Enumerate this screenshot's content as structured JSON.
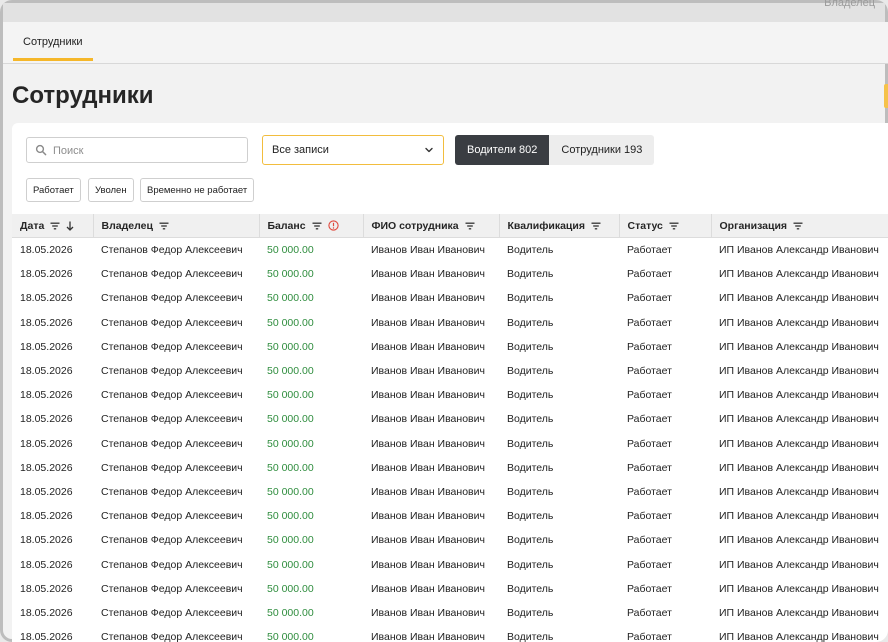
{
  "topbar": {
    "owner_link": "Владелец"
  },
  "tabs": [
    {
      "label": "Сотрудники"
    }
  ],
  "page": {
    "title": "Сотрудники"
  },
  "toolbar": {
    "search": {
      "placeholder": "Поиск",
      "value": ""
    },
    "records_select": {
      "value": "Все записи"
    },
    "segments": [
      {
        "label": "Водители 802",
        "active": true
      },
      {
        "label": "Сотрудники 193",
        "active": false
      }
    ],
    "status_chips": [
      "Работает",
      "Уволен",
      "Временно не работает"
    ]
  },
  "colors": {
    "accent": "#f5b72a",
    "money": "#2f8d3e",
    "segment_active": "#3a3d42",
    "info_icon": "#e0483c"
  },
  "table": {
    "columns": [
      {
        "label": "Дата",
        "filter": true,
        "sorted": "desc"
      },
      {
        "label": "Владелец",
        "filter": true
      },
      {
        "label": "Баланс",
        "filter": true,
        "info": true
      },
      {
        "label": "ФИО сотрудника",
        "filter": true
      },
      {
        "label": "Квалификация",
        "filter": true
      },
      {
        "label": "Статус",
        "filter": true
      },
      {
        "label": "Организация",
        "filter": true
      }
    ],
    "rows": [
      [
        "18.05.2026",
        "Степанов Федор Алексеевич",
        "50 000.00",
        "Иванов Иван Иванович",
        "Водитель",
        "Работает",
        "ИП Иванов Александр Иванович"
      ],
      [
        "18.05.2026",
        "Степанов Федор Алексеевич",
        "50 000.00",
        "Иванов Иван Иванович",
        "Водитель",
        "Работает",
        "ИП Иванов Александр Иванович"
      ],
      [
        "18.05.2026",
        "Степанов Федор Алексеевич",
        "50 000.00",
        "Иванов Иван Иванович",
        "Водитель",
        "Работает",
        "ИП Иванов Александр Иванович"
      ],
      [
        "18.05.2026",
        "Степанов Федор Алексеевич",
        "50 000.00",
        "Иванов Иван Иванович",
        "Водитель",
        "Работает",
        "ИП Иванов Александр Иванович"
      ],
      [
        "18.05.2026",
        "Степанов Федор Алексеевич",
        "50 000.00",
        "Иванов Иван Иванович",
        "Водитель",
        "Работает",
        "ИП Иванов Александр Иванович"
      ],
      [
        "18.05.2026",
        "Степанов Федор Алексеевич",
        "50 000.00",
        "Иванов Иван Иванович",
        "Водитель",
        "Работает",
        "ИП Иванов Александр Иванович"
      ],
      [
        "18.05.2026",
        "Степанов Федор Алексеевич",
        "50 000.00",
        "Иванов Иван Иванович",
        "Водитель",
        "Работает",
        "ИП Иванов Александр Иванович"
      ],
      [
        "18.05.2026",
        "Степанов Федор Алексеевич",
        "50 000.00",
        "Иванов Иван Иванович",
        "Водитель",
        "Работает",
        "ИП Иванов Александр Иванович"
      ],
      [
        "18.05.2026",
        "Степанов Федор Алексеевич",
        "50 000.00",
        "Иванов Иван Иванович",
        "Водитель",
        "Работает",
        "ИП Иванов Александр Иванович"
      ],
      [
        "18.05.2026",
        "Степанов Федор Алексеевич",
        "50 000.00",
        "Иванов Иван Иванович",
        "Водитель",
        "Работает",
        "ИП Иванов Александр Иванович"
      ],
      [
        "18.05.2026",
        "Степанов Федор Алексеевич",
        "50 000.00",
        "Иванов Иван Иванович",
        "Водитель",
        "Работает",
        "ИП Иванов Александр Иванович"
      ],
      [
        "18.05.2026",
        "Степанов Федор Алексеевич",
        "50 000.00",
        "Иванов Иван Иванович",
        "Водитель",
        "Работает",
        "ИП Иванов Александр Иванович"
      ],
      [
        "18.05.2026",
        "Степанов Федор Алексеевич",
        "50 000.00",
        "Иванов Иван Иванович",
        "Водитель",
        "Работает",
        "ИП Иванов Александр Иванович"
      ],
      [
        "18.05.2026",
        "Степанов Федор Алексеевич",
        "50 000.00",
        "Иванов Иван Иванович",
        "Водитель",
        "Работает",
        "ИП Иванов Александр Иванович"
      ],
      [
        "18.05.2026",
        "Степанов Федор Алексеевич",
        "50 000.00",
        "Иванов Иван Иванович",
        "Водитель",
        "Работает",
        "ИП Иванов Александр Иванович"
      ],
      [
        "18.05.2026",
        "Степанов Федор Алексеевич",
        "50 000.00",
        "Иванов Иван Иванович",
        "Водитель",
        "Работает",
        "ИП Иванов Александр Иванович"
      ],
      [
        "18.05.2026",
        "Степанов Федор Алексеевич",
        "50 000.00",
        "Иванов Иван Иванович",
        "Водитель",
        "Работает",
        "ИП Иванов Александр Иванович"
      ]
    ]
  }
}
